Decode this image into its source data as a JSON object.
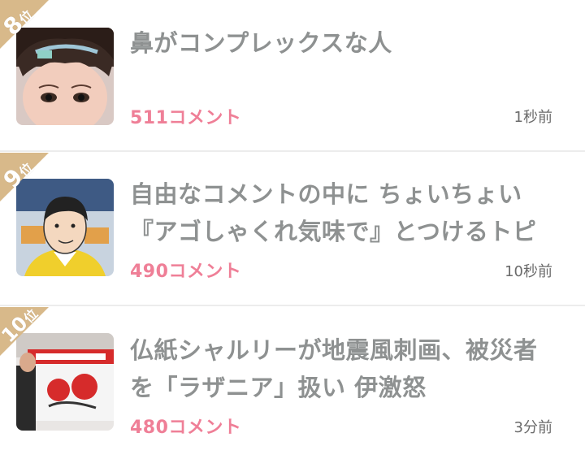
{
  "colors": {
    "rank_badge": "#d8b98a",
    "title_text": "#8e9191",
    "comment_count": "#ef7f97",
    "timestamp": "#6b6b6b",
    "divider": "#ececec"
  },
  "items": [
    {
      "rank_number": "8",
      "rank_suffix": "位",
      "title": "鼻がコンプレックスな人",
      "comments": "511コメント",
      "time": "1秒前",
      "thumbnail": "woman-face-photo"
    },
    {
      "rank_number": "9",
      "rank_suffix": "位",
      "title": "自由なコメントの中に ちょいちょい『アゴしゃくれ気味で』とつけるトピ",
      "comments": "490コメント",
      "time": "10秒前",
      "thumbnail": "illustrated-man-yellow-jacket"
    },
    {
      "rank_number": "10",
      "rank_suffix": "位",
      "title": "仏紙シャルリーが地震風刺画、被災者を「ラザニア」扱い 伊激怒",
      "comments": "480コメント",
      "time": "3分前",
      "thumbnail": "magazine-cover-photo"
    }
  ]
}
